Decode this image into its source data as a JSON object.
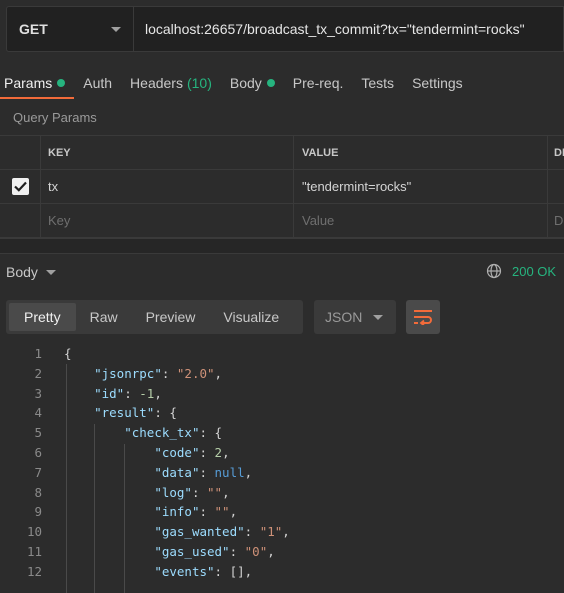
{
  "request": {
    "method": "GET",
    "url": "localhost:26657/broadcast_tx_commit?tx=\"tendermint=rocks\""
  },
  "tabs": [
    {
      "label": "Params",
      "dot": true
    },
    {
      "label": "Auth"
    },
    {
      "label": "Headers",
      "count": "(10)"
    },
    {
      "label": "Body",
      "dot": true
    },
    {
      "label": "Pre-req."
    },
    {
      "label": "Tests"
    },
    {
      "label": "Settings"
    }
  ],
  "query_params": {
    "title": "Query Params",
    "columns": [
      "KEY",
      "VALUE",
      "DE"
    ],
    "rows": [
      {
        "checked": true,
        "key": "tx",
        "value": "\"tendermint=rocks\"",
        "description": ""
      }
    ],
    "placeholder": {
      "key": "Key",
      "value": "Value",
      "description": "D"
    }
  },
  "response": {
    "body_label": "Body",
    "status": "200 OK",
    "view_tabs": [
      "Pretty",
      "Raw",
      "Preview",
      "Visualize"
    ],
    "active_view": "Pretty",
    "format": "JSON"
  },
  "code_lines": [
    {
      "n": "1",
      "text": "{"
    },
    {
      "n": "2",
      "text": "    \"jsonrpc\": \"2.0\","
    },
    {
      "n": "3",
      "text": "    \"id\": -1,"
    },
    {
      "n": "4",
      "text": "    \"result\": {"
    },
    {
      "n": "5",
      "text": "        \"check_tx\": {"
    },
    {
      "n": "6",
      "text": "            \"code\": 2,"
    },
    {
      "n": "7",
      "text": "            \"data\": null,"
    },
    {
      "n": "8",
      "text": "            \"log\": \"\","
    },
    {
      "n": "9",
      "text": "            \"info\": \"\","
    },
    {
      "n": "10",
      "text": "            \"gas_wanted\": \"1\","
    },
    {
      "n": "11",
      "text": "            \"gas_used\": \"0\","
    },
    {
      "n": "12",
      "text": "            \"events\": [],"
    }
  ],
  "colors": {
    "accent": "#f26b3a",
    "success": "#26b47f",
    "json_key": "#9cdcfe",
    "json_string": "#ce9178",
    "json_number": "#b5cea8",
    "json_null": "#569cd6"
  }
}
